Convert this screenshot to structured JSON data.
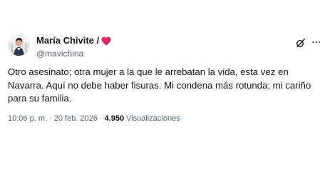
{
  "author": {
    "display_name": "María Chivite /",
    "handle": "@mavichina",
    "avatar_icon": "profile-photo",
    "badge_icon": "red-heart-icon",
    "badge_color": "#e0245e"
  },
  "tweet": {
    "text": "Otro asesinato; otra mujer a la que le arrebatan la vida, esta vez en\nNavarra. Aquí no debe haber fisuras. Mi condena más rotunda; mi cariño\npara su familia."
  },
  "meta": {
    "time": "10:06 p. m.",
    "separator": "·",
    "date": "20 feb. 2026",
    "views_count": "4.950",
    "views_label": "Visualizaciones"
  },
  "actions": {
    "grok_icon": "grok-slash-icon",
    "more_icon": "more-options-icon"
  }
}
